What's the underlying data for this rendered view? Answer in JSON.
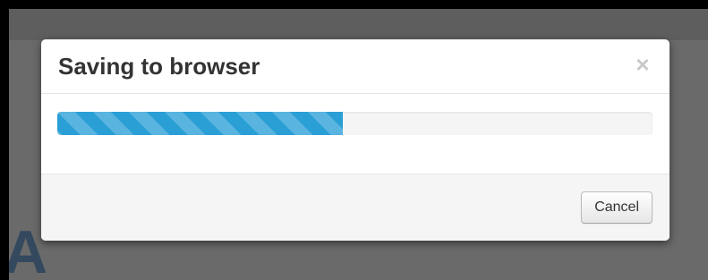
{
  "dialog": {
    "title": "Saving to browser",
    "close_glyph": "×",
    "progress_percent": 48,
    "cancel_label": "Cancel"
  },
  "background": {
    "glyph": "A"
  },
  "colors": {
    "progress_fill": "#2a9fd6",
    "progress_track": "#f5f5f5",
    "backdrop": "#6a6a6a"
  },
  "icons": {
    "close": "close-icon"
  }
}
